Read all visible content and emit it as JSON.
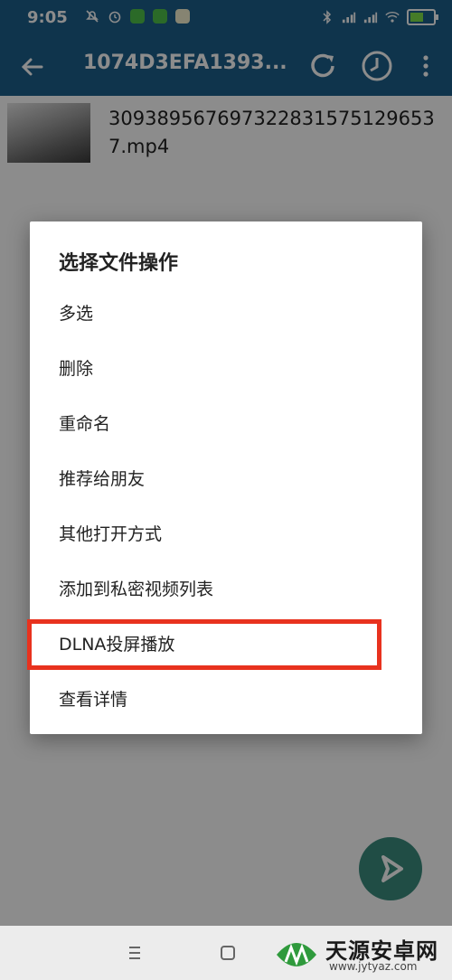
{
  "status_bar": {
    "time": "9:05",
    "left_icons": [
      "mute-icon",
      "alarm-icon",
      "app-badge-green",
      "app-badge-green",
      "app-badge-yellow"
    ],
    "right_icons": [
      "bluetooth-icon",
      "signal-icon",
      "signal-icon",
      "wifi-icon",
      "battery-icon"
    ],
    "battery_color": "#7fe14a"
  },
  "app_bar": {
    "title": "1074D3EFA1393...",
    "color": "#1d5f8a"
  },
  "file": {
    "name": "3093895676973228315751296537.mp4"
  },
  "dialog": {
    "title": "选择文件操作",
    "items": [
      {
        "label": "多选"
      },
      {
        "label": "删除"
      },
      {
        "label": "重命名"
      },
      {
        "label": "推荐给朋友"
      },
      {
        "label": "其他打开方式"
      },
      {
        "label": "添加到私密视频列表"
      },
      {
        "label": "DLNA投屏播放"
      },
      {
        "label": "查看详情"
      }
    ],
    "highlighted_item": "DLNA投屏播放",
    "highlight_color": "#e8321e"
  },
  "fab": {
    "icon": "play-icon",
    "color": "#3b8d7f"
  },
  "nav_bar": {
    "icons": [
      "menu-icon",
      "home-icon"
    ]
  },
  "watermark": {
    "text": "天源安卓网",
    "url": "www.jytyaz.com"
  }
}
